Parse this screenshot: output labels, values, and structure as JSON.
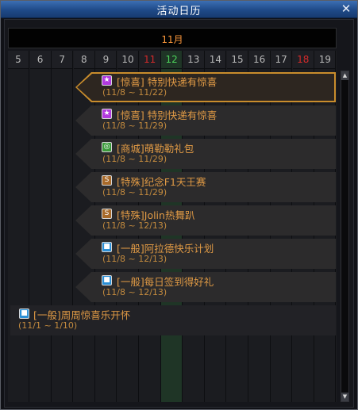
{
  "window": {
    "title": "活动日历",
    "close_label": "✕"
  },
  "calendar": {
    "month": "11月",
    "days": [
      {
        "label": "5",
        "color": "normal"
      },
      {
        "label": "6",
        "color": "normal"
      },
      {
        "label": "7",
        "color": "normal"
      },
      {
        "label": "8",
        "color": "normal"
      },
      {
        "label": "9",
        "color": "normal"
      },
      {
        "label": "10",
        "color": "normal"
      },
      {
        "label": "11",
        "color": "red"
      },
      {
        "label": "12",
        "color": "green"
      },
      {
        "label": "13",
        "color": "normal"
      },
      {
        "label": "14",
        "color": "normal"
      },
      {
        "label": "15",
        "color": "normal"
      },
      {
        "label": "16",
        "color": "normal"
      },
      {
        "label": "17",
        "color": "normal"
      },
      {
        "label": "18",
        "color": "red"
      },
      {
        "label": "19",
        "color": "normal"
      }
    ]
  },
  "events": [
    {
      "name": "[惊喜] 特别快递有惊喜",
      "dates": "(11/8 ~ 11/22)",
      "icon": "star-icon",
      "icon_color": "#b23adf",
      "icon_glyph": "★",
      "selected": true
    },
    {
      "name": "[惊喜] 特别快递有惊喜",
      "dates": "(11/8 ~ 11/29)",
      "icon": "star-icon",
      "icon_color": "#b23adf",
      "icon_glyph": "★",
      "selected": false
    },
    {
      "name": "[商城]萌勒勒礼包",
      "dates": "(11/8 ~ 11/29)",
      "icon": "shop-icon",
      "icon_color": "#3a9a3a",
      "icon_glyph": "◎",
      "selected": false
    },
    {
      "name": "[特殊]纪念F1天王赛",
      "dates": "(11/8 ~ 11/29)",
      "icon": "special-icon",
      "icon_color": "#a86a2a",
      "icon_glyph": "S",
      "selected": false
    },
    {
      "name": "[特殊]Jolin热舞趴",
      "dates": "(11/8 ~ 12/13)",
      "icon": "special-icon",
      "icon_color": "#a86a2a",
      "icon_glyph": "S",
      "selected": false
    },
    {
      "name": "[一般]阿拉德快乐计划",
      "dates": "(11/8 ~ 12/13)",
      "icon": "general-icon",
      "icon_color": "#2a8fd6",
      "icon_glyph": "■",
      "selected": false
    },
    {
      "name": "[一般]每日签到得好礼",
      "dates": "(11/8 ~ 12/13)",
      "icon": "general-icon",
      "icon_color": "#2a8fd6",
      "icon_glyph": "■",
      "selected": false
    },
    {
      "name": "[一般]周周惊喜乐开怀",
      "dates": "(11/1 ~ 1/10)",
      "icon": "general-icon",
      "icon_color": "#2a8fd6",
      "icon_glyph": "■",
      "selected": false
    }
  ],
  "scrollbar": {
    "up": "▲",
    "down": "▼"
  }
}
